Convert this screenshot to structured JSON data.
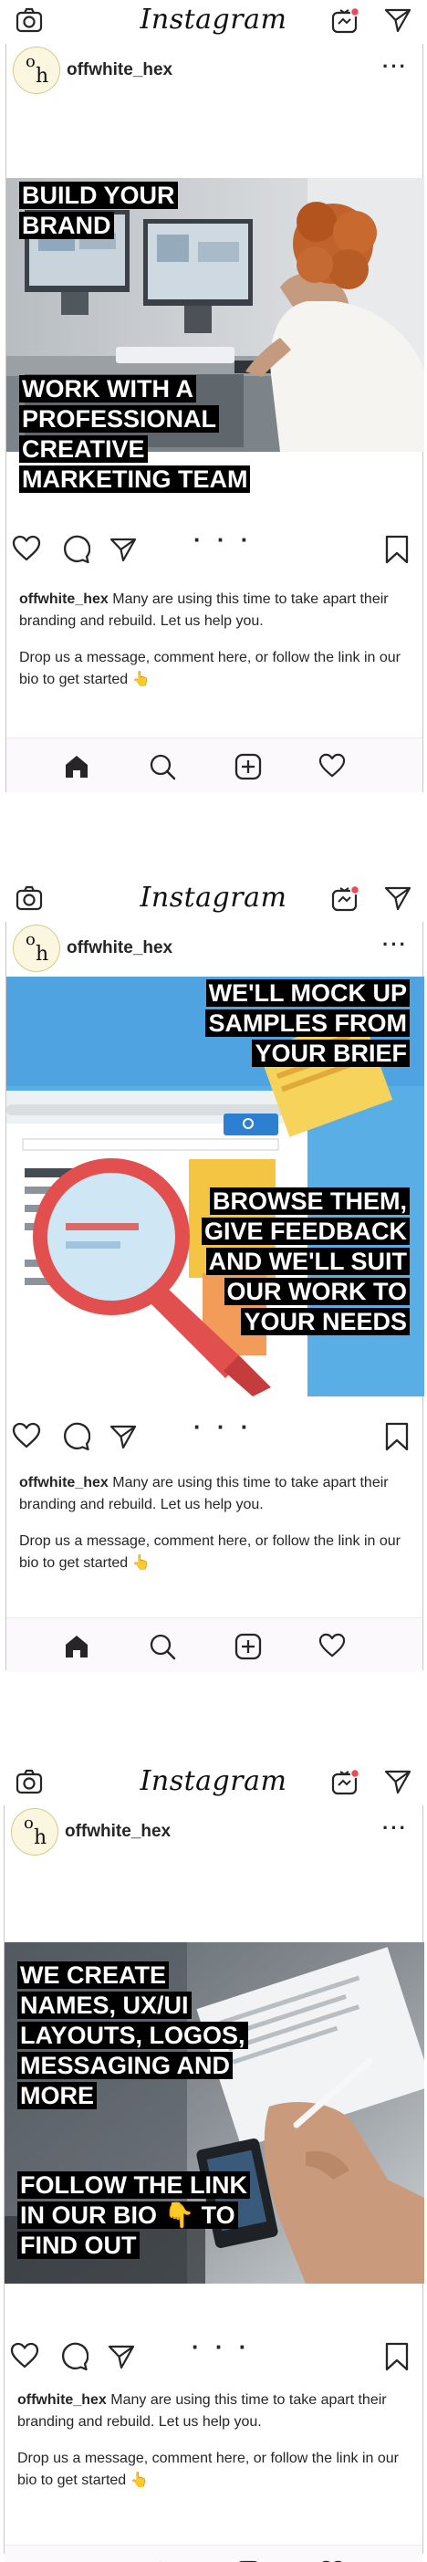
{
  "app": {
    "logo_text": "Instagram"
  },
  "posts": [
    {
      "username": "offwhite_hex",
      "avatar": {
        "letter_top": "o",
        "letter_bottom": "h"
      },
      "more": "···",
      "image_style": "office-photo",
      "captions": [
        "BUILD YOUR BRAND",
        "WORK WITH A PROFESSIONAL CREATIVE MARKETING TEAM"
      ],
      "carousel_indicator": "· · ·",
      "caption": {
        "username": "offwhite_hex",
        "text": " Many are using this time to take apart their branding and rebuild. Let us help you.",
        "paragraph2": "Drop us a message, comment here, or follow the link in our bio to get started 👆"
      }
    },
    {
      "username": "offwhite_hex",
      "avatar": {
        "letter_top": "o",
        "letter_bottom": "h"
      },
      "more": "···",
      "image_style": "magnifier-illustration",
      "captions": [
        "WE'LL MOCK UP SAMPLES FROM YOUR BRIEF",
        "BROWSE THEM, GIVE FEEDBACK AND WE'LL SUIT OUR WORK TO YOUR NEEDS"
      ],
      "carousel_indicator": "· · ·",
      "caption": {
        "username": "offwhite_hex",
        "text": " Many are using this time to take apart their branding and rebuild. Let us help you.",
        "paragraph2": "Drop us a message, comment here, or follow the link in our bio to get started 👆"
      }
    },
    {
      "username": "offwhite_hex",
      "avatar": {
        "letter_top": "o",
        "letter_bottom": "h"
      },
      "more": "···",
      "image_style": "desk-photo",
      "captions": [
        "WE CREATE NAMES, UX/UI LAYOUTS, LOGOS, MESSAGING AND MORE",
        "FOLLOW THE LINK IN OUR BIO 👇 TO FIND OUT"
      ],
      "carousel_indicator": "· · ·",
      "caption": {
        "username": "offwhite_hex",
        "text": " Many are using this time to take apart their branding and rebuild. Let us help you.",
        "paragraph2": "Drop us a message, comment here, or follow the link in our bio to get started 👆"
      }
    }
  ],
  "icons": {
    "camera": "camera-icon",
    "igtv": "igtv-icon",
    "direct": "direct-message-icon",
    "like": "heart-icon",
    "comment": "comment-icon",
    "share": "share-icon",
    "save": "bookmark-icon",
    "home": "home-icon",
    "search": "search-icon",
    "add": "add-post-icon",
    "activity": "activity-heart-icon"
  },
  "colors": {
    "text": "#262626",
    "notification": "#ed4956",
    "nav_bg": "#fbf9fb"
  }
}
